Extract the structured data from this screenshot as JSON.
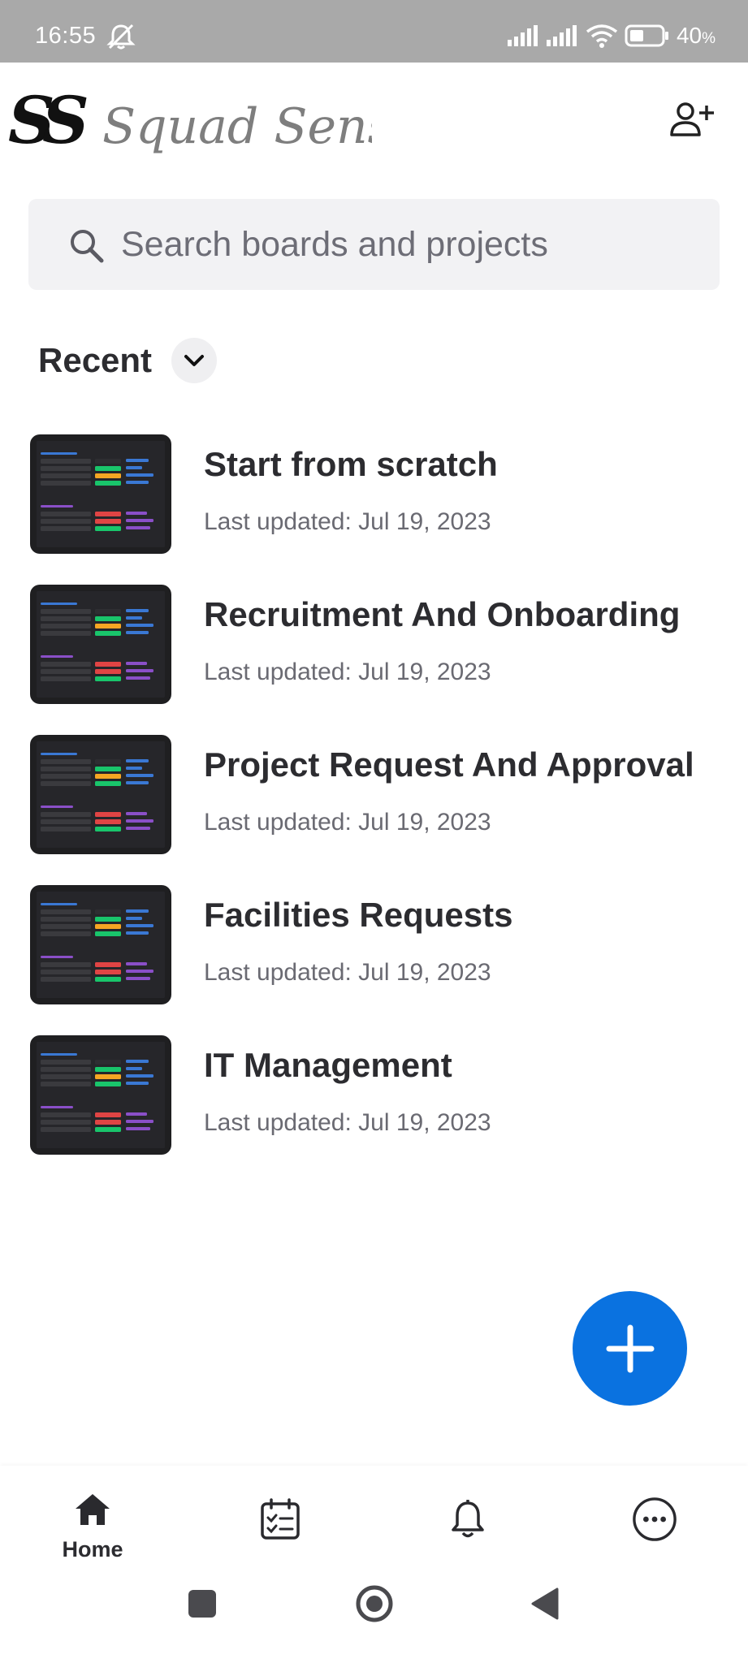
{
  "status_bar": {
    "time": "16:55",
    "battery_percent": "40",
    "battery_unit": "%",
    "icons": [
      "bell-off-icon",
      "signal-icon",
      "signal-icon",
      "wifi-icon",
      "battery-icon"
    ]
  },
  "header": {
    "logo_text": "Squad Sense",
    "logo_mark": "SS",
    "add_user_icon": "add-user-icon"
  },
  "search": {
    "placeholder": "Search boards and projects"
  },
  "recent": {
    "label": "Recent"
  },
  "boards": [
    {
      "title": "Start from scratch",
      "updated": "Last updated: Jul 19, 2023"
    },
    {
      "title": "Recruitment And Onboarding",
      "updated": "Last updated: Jul 19, 2023"
    },
    {
      "title": "Project Request And Approval",
      "updated": "Last updated: Jul 19, 2023"
    },
    {
      "title": "Facilities Requests",
      "updated": "Last updated: Jul 19, 2023"
    },
    {
      "title": "IT Management",
      "updated": "Last updated: Jul 19, 2023"
    }
  ],
  "bottom_nav": {
    "home_label": "Home",
    "items": [
      "home-icon",
      "calendar-check-icon",
      "bell-icon",
      "more-icon"
    ]
  },
  "colors": {
    "accent": "#0a72e0",
    "status_bar": "#a9a9a9",
    "thumb_green": "#19c56b",
    "thumb_orange": "#f5a623",
    "thumb_red": "#e04444",
    "thumb_blue": "#3a78d4",
    "thumb_purple": "#8a4fc8"
  }
}
